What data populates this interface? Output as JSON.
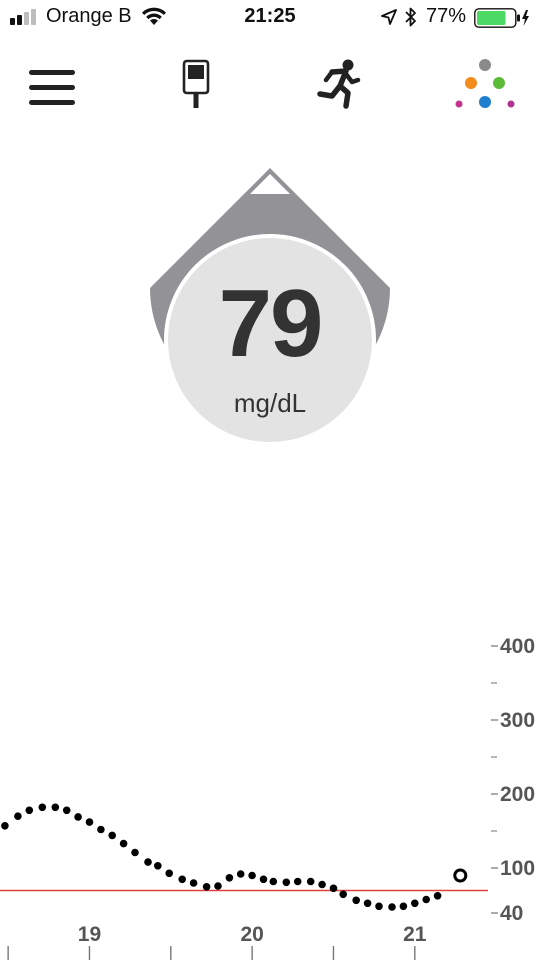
{
  "status_bar": {
    "carrier": "Orange B",
    "time": "21:25",
    "battery_percent": "77%",
    "battery_level": 0.77,
    "battery_color": "#4cd964",
    "signal_bars": 2,
    "icons": [
      "signal-icon",
      "wifi-icon",
      "location-arrow-icon",
      "bluetooth-icon",
      "battery-icon",
      "charging-bolt-icon"
    ]
  },
  "toolbar": {
    "items": [
      {
        "name": "menu",
        "icon": "hamburger-menu-icon"
      },
      {
        "name": "meter",
        "icon": "glucose-meter-icon"
      },
      {
        "name": "activity",
        "icon": "running-person-icon"
      },
      {
        "name": "events",
        "icon": "colored-dots-icon"
      }
    ],
    "dot_colors": [
      "#8a8a8a",
      "#f28c1b",
      "#5dbb3a",
      "#c2338a",
      "#1f7fcf",
      "#b0338f"
    ]
  },
  "glucose": {
    "value": "79",
    "unit": "mg/dL",
    "trend": "up-triangle-icon",
    "ring_color": "#939296",
    "face_color": "#e3e3e3"
  },
  "chart_data": {
    "type": "scatter",
    "title": "",
    "xlabel": "",
    "ylabel": "",
    "x_tick_labels": [
      "19",
      "20",
      "21"
    ],
    "x_ticks": [
      19,
      20,
      21
    ],
    "xlim": [
      18.45,
      21.45
    ],
    "y_ticks": [
      400,
      300,
      200,
      100,
      40
    ],
    "y_minor_ticks": [
      350,
      250,
      150
    ],
    "y_tick_labels": [
      "400",
      "300",
      "200",
      "100",
      "40"
    ],
    "y_scale": "piecewise: 40 to 100 compressed, 100 to 400 linear",
    "threshold": 70,
    "threshold_color": "#e0413a",
    "series": [
      {
        "values": [
          [
            18.48,
            157
          ],
          [
            18.56,
            170
          ],
          [
            18.63,
            178
          ],
          [
            18.71,
            182
          ],
          [
            18.79,
            182
          ],
          [
            18.86,
            178
          ],
          [
            18.93,
            169
          ],
          [
            19.0,
            162
          ],
          [
            19.07,
            152
          ],
          [
            19.14,
            144
          ],
          [
            19.21,
            133
          ],
          [
            19.28,
            121
          ],
          [
            19.36,
            108
          ],
          [
            19.42,
            103
          ],
          [
            19.49,
            93
          ],
          [
            19.57,
            85
          ],
          [
            19.64,
            80
          ],
          [
            19.72,
            75
          ],
          [
            19.79,
            76
          ],
          [
            19.86,
            87
          ],
          [
            19.93,
            92
          ],
          [
            20.0,
            90
          ],
          [
            20.07,
            85
          ],
          [
            20.13,
            82
          ],
          [
            20.21,
            81
          ],
          [
            20.28,
            82
          ],
          [
            20.36,
            82
          ],
          [
            20.43,
            78
          ],
          [
            20.5,
            73
          ],
          [
            20.56,
            65
          ],
          [
            20.64,
            57
          ],
          [
            20.71,
            53
          ],
          [
            20.78,
            49
          ],
          [
            20.86,
            48
          ],
          [
            20.93,
            49
          ],
          [
            21.0,
            53
          ],
          [
            21.07,
            58
          ],
          [
            21.14,
            63
          ]
        ]
      }
    ],
    "current_point": [
      21.28,
      90
    ],
    "point_color": "#000000"
  }
}
